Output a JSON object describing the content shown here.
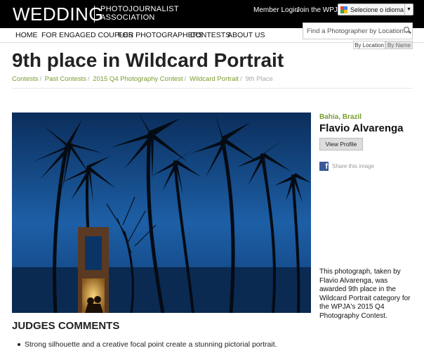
{
  "header": {
    "logo_main": "WEDDING",
    "logo_sub_line1": "PHOTOJOURNALIST",
    "logo_sub_line2": "ASSOCIATION",
    "member_login": "Member Login",
    "join": "Join the WPJA",
    "language": "Selecione o idioma",
    "language_arrow": "▼"
  },
  "nav": {
    "items": [
      "HOME",
      "FOR ENGAGED COUPLES",
      "FOR PHOTOGRAPHERS",
      "CONTESTS",
      "ABOUT US"
    ]
  },
  "search": {
    "placeholder": "Find a Photographer by Location...",
    "tab_location": "By Location",
    "tab_name": "By Name"
  },
  "page": {
    "title": "9th place in Wildcard Portrait",
    "breadcrumb": [
      "Contests",
      "Past Contests",
      "2015 Q4 Photography Contest",
      "Wildcard Portrait",
      "9th Place"
    ]
  },
  "sidebar": {
    "location": "Bahia, Brazil",
    "photographer": "Flavio Alvarenga",
    "view_profile": "View Profile",
    "share": "Share this image",
    "caption": "This photograph, taken by Flavio Alvarenga, was awarded 9th place in the Wildcard Portrait category for the WPJA's 2015 Q4 Photography Contest."
  },
  "judges": {
    "heading": "JUDGES COMMENTS",
    "comments": [
      "Strong silhouette and a creative focal point create a stunning pictorial portrait."
    ]
  },
  "colors": {
    "accent_green": "#7a9c2e",
    "topbar": "#000000",
    "facebook": "#3b5998"
  }
}
